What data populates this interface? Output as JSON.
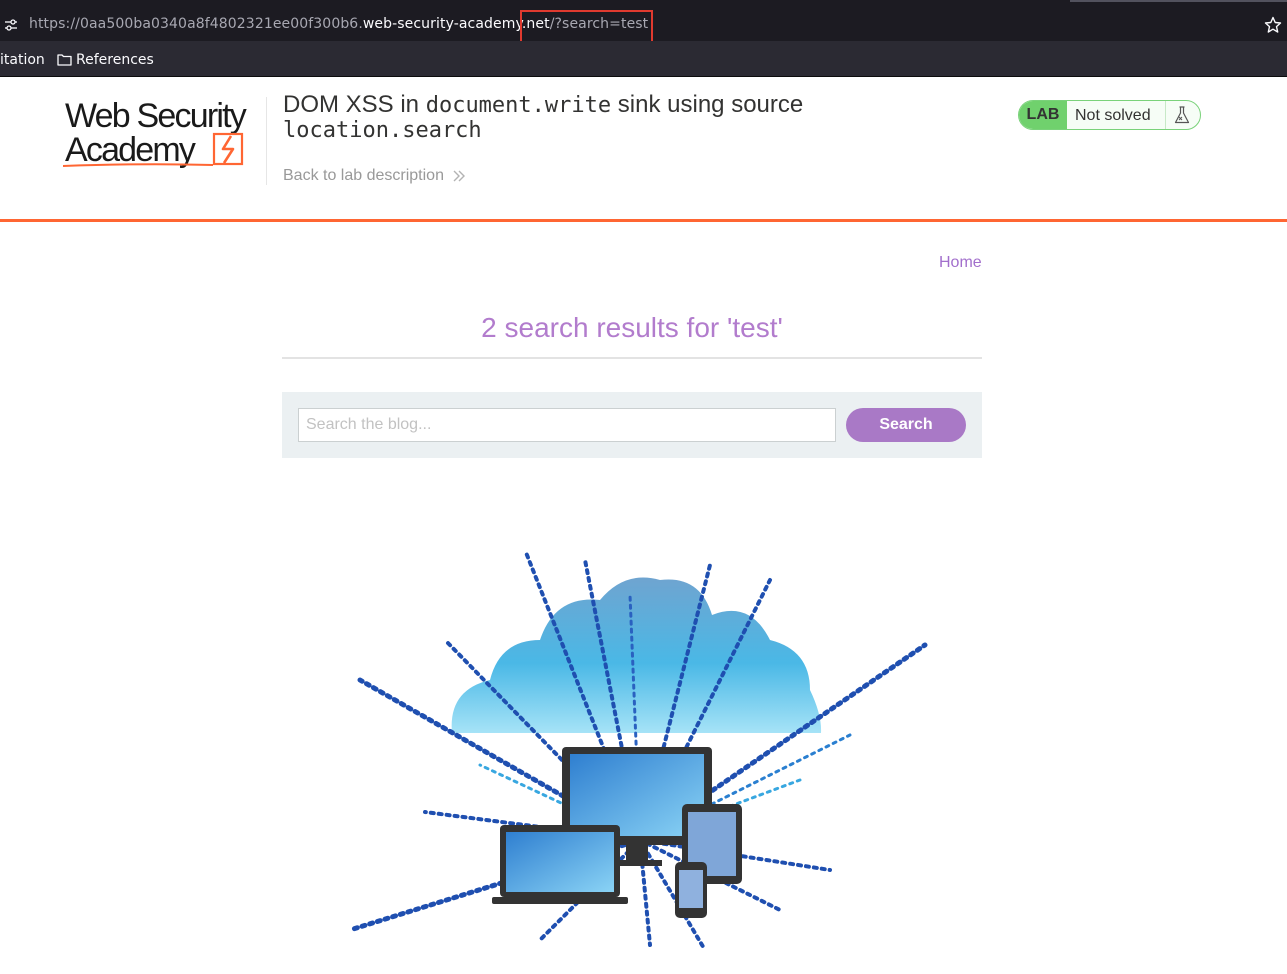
{
  "browser": {
    "url_prefix": "https://0aa500ba0340a8f4802321ee00f300b6.",
    "url_domain": "web-security-academy.net",
    "url_path": "/?search=test",
    "bookmarks": [
      "itation",
      "References"
    ]
  },
  "lab": {
    "title_part1": "DOM XSS in ",
    "title_code1": "document.write",
    "title_part2": " sink using source",
    "title_code2": "location.search",
    "back_link": "Back to lab description",
    "status_badge": "LAB",
    "status_text": "Not solved"
  },
  "nav": {
    "home": "Home"
  },
  "search": {
    "results_heading": "2 search results for 'test'",
    "placeholder": "Search the blog...",
    "button": "Search"
  },
  "colors": {
    "accent_orange": "#ff6633",
    "heading_purple": "#b27ccd",
    "button_purple": "#a979c6",
    "status_green": "#70d16d"
  }
}
